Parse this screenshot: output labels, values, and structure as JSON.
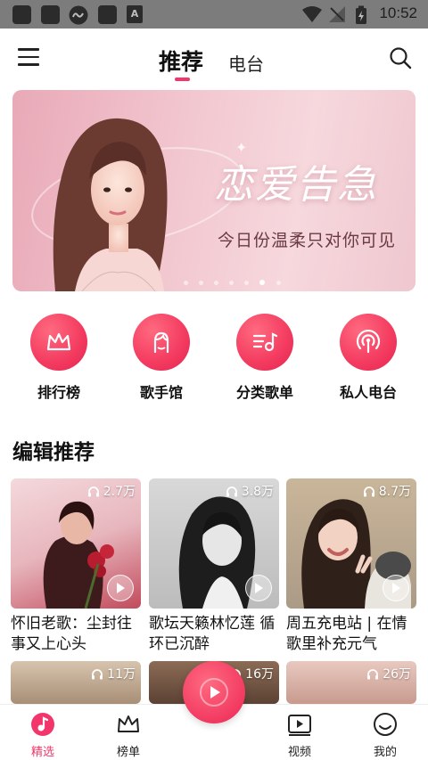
{
  "status_bar": {
    "time": "10:52",
    "badge_letter": "A"
  },
  "header": {
    "tabs": [
      {
        "label": "推荐",
        "active": true
      },
      {
        "label": "电台",
        "active": false
      }
    ],
    "icons": {
      "menu": "menu-icon",
      "search": "search-icon"
    }
  },
  "banner": {
    "title": "恋爱告急",
    "subtitle": "今日份温柔只对你可见",
    "dot_count": 7,
    "active_dot": 6
  },
  "quick_nav": [
    {
      "label": "排行榜",
      "icon": "crown-icon"
    },
    {
      "label": "歌手馆",
      "icon": "singer-icon"
    },
    {
      "label": "分类歌单",
      "icon": "playlist-icon"
    },
    {
      "label": "私人电台",
      "icon": "radio-icon"
    }
  ],
  "section": {
    "title": "编辑推荐"
  },
  "playlists": [
    {
      "plays": "2.7万",
      "title": "怀旧老歌：尘封往事又上心头"
    },
    {
      "plays": "3.8万",
      "title": "歌坛天籁林忆莲 循环已沉醉"
    },
    {
      "plays": "8.7万",
      "title": "周五充电站 | 在情歌里补充元气"
    },
    {
      "plays": "11万",
      "title": ""
    },
    {
      "plays": "16万",
      "title": ""
    },
    {
      "plays": "26万",
      "title": ""
    }
  ],
  "bottom_nav": [
    {
      "label": "精选",
      "icon": "music-note-icon",
      "active": true
    },
    {
      "label": "榜单",
      "icon": "crown-icon",
      "active": false
    },
    {
      "label": "视频",
      "icon": "video-icon",
      "active": false
    },
    {
      "label": "我的",
      "icon": "smile-icon",
      "active": false
    }
  ],
  "colors": {
    "accent": "#f2356a",
    "status_bar": "#7c7c7c"
  }
}
